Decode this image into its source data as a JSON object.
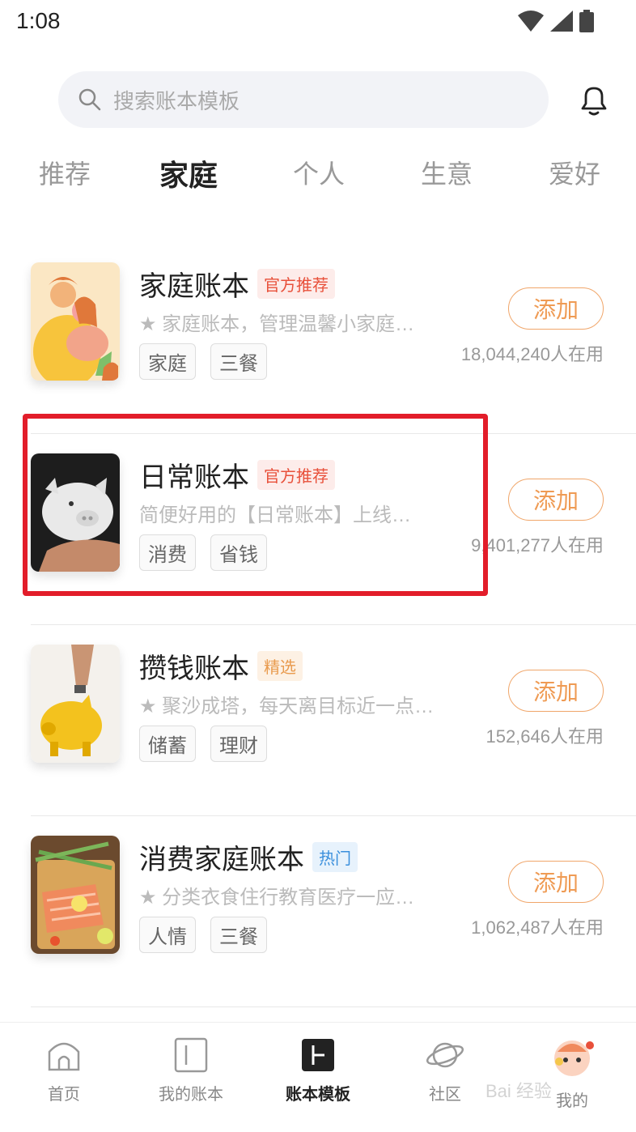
{
  "status": {
    "time": "1:08",
    "icons": [
      "wifi-icon",
      "signal-icon",
      "battery-icon"
    ]
  },
  "search": {
    "placeholder": "搜索账本模板",
    "icon": "search-icon"
  },
  "header": {
    "bell_icon": "bell-icon"
  },
  "tabs": [
    {
      "label": "推荐",
      "active": false
    },
    {
      "label": "家庭",
      "active": true
    },
    {
      "label": "个人",
      "active": false
    },
    {
      "label": "生意",
      "active": false
    },
    {
      "label": "爱好",
      "active": false
    }
  ],
  "templates": [
    {
      "title": "家庭账本",
      "badge": "官方推荐",
      "badge_style": "red",
      "desc": "★ 家庭账本，管理温馨小家庭…",
      "tags": [
        "家庭",
        "三餐"
      ],
      "button": "添加",
      "users": "18,044,240人在用"
    },
    {
      "title": "日常账本",
      "badge": "官方推荐",
      "badge_style": "red",
      "desc": "简便好用的【日常账本】上线…",
      "tags": [
        "消费",
        "省钱"
      ],
      "button": "添加",
      "users": "9,401,277人在用"
    },
    {
      "title": "攒钱账本",
      "badge": "精选",
      "badge_style": "orange",
      "desc": "★ 聚沙成塔，每天离目标近一点…",
      "tags": [
        "储蓄",
        "理财"
      ],
      "button": "添加",
      "users": "152,646人在用"
    },
    {
      "title": "消费家庭账本",
      "badge": "热门",
      "badge_style": "blue",
      "desc": "★ 分类衣食住行教育医疗一应…",
      "tags": [
        "人情",
        "三餐"
      ],
      "button": "添加",
      "users": "1,062,487人在用"
    }
  ],
  "bottom_nav": [
    {
      "label": "首页",
      "icon": "home-icon",
      "active": false
    },
    {
      "label": "我的账本",
      "icon": "book-icon",
      "active": false
    },
    {
      "label": "账本模板",
      "icon": "template-icon",
      "active": true
    },
    {
      "label": "社区",
      "icon": "planet-icon",
      "active": false
    },
    {
      "label": "我的",
      "icon": "avatar-icon",
      "active": false
    }
  ],
  "watermark": "Bai 经验",
  "colors": {
    "accent": "#ef9b54",
    "highlight": "#e21d2a",
    "tab_underline": "#f5b57a"
  }
}
